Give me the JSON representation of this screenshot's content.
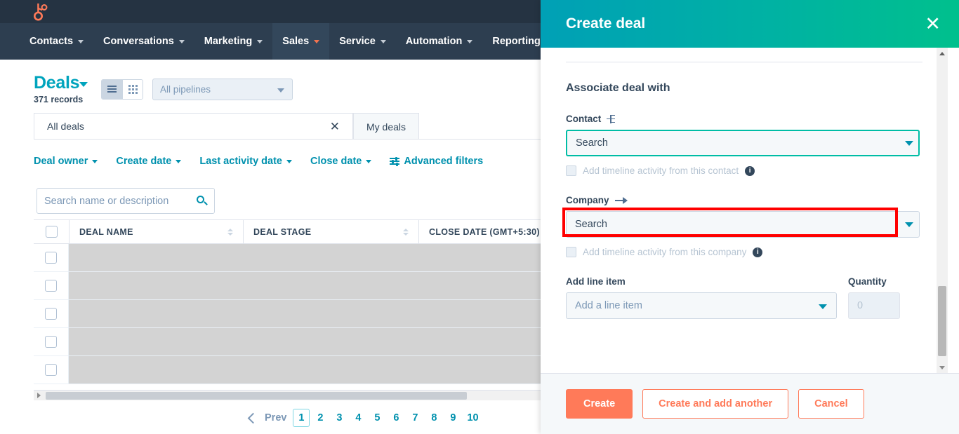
{
  "app": {
    "logo_icon": "hubspot-sprocket-logo",
    "nav_items": [
      {
        "label": "Contacts",
        "active": false
      },
      {
        "label": "Conversations",
        "active": false
      },
      {
        "label": "Marketing",
        "active": false
      },
      {
        "label": "Sales",
        "active": true
      },
      {
        "label": "Service",
        "active": false
      },
      {
        "label": "Automation",
        "active": false
      },
      {
        "label": "Reporting",
        "active": false
      }
    ]
  },
  "deals": {
    "title": "Deals",
    "record_count": "371 records",
    "view_list_icon": "list-view-icon",
    "view_grid_icon": "grid-view-icon",
    "pipeline_filter": "All pipelines",
    "tabs": [
      {
        "label": "All deals",
        "active": true,
        "closable": true
      },
      {
        "label": "My deals",
        "active": false,
        "closable": false
      }
    ],
    "close_tab_icon": "close-icon",
    "filters": [
      {
        "label": "Deal owner",
        "caret": true
      },
      {
        "label": "Create date",
        "caret": true
      },
      {
        "label": "Last activity date",
        "caret": true
      },
      {
        "label": "Close date",
        "caret": true
      },
      {
        "label": "Advanced filters",
        "caret": false,
        "icon": "filter-sliders-icon"
      }
    ],
    "search_placeholder": "Search name or description",
    "search_value": "",
    "search_icon": "search-icon",
    "columns": [
      {
        "label": "DEAL NAME",
        "sortable": true
      },
      {
        "label": "DEAL STAGE",
        "sortable": true
      },
      {
        "label": "CLOSE DATE (GMT+5:30)",
        "sortable": false
      }
    ],
    "row_count": 5,
    "pagination": {
      "prev_label": "Prev",
      "prev_icon": "chevron-left-icon",
      "current": "1",
      "pages": [
        "1",
        "2",
        "3",
        "4",
        "5",
        "6",
        "7",
        "8",
        "9",
        "10"
      ]
    }
  },
  "panel": {
    "title": "Create deal",
    "close_icon": "close-icon",
    "section_title": "Associate deal with",
    "contact": {
      "label": "Contact",
      "icon": "association-icon",
      "placeholder": "Search",
      "value": "",
      "focused": true,
      "checkbox_label": "Add timeline activity from this contact",
      "checkbox_checked": false,
      "info_icon": "info-icon"
    },
    "company": {
      "label": "Company",
      "icon": "arrow-right-icon",
      "placeholder": "Search",
      "value": "",
      "highlighted": true,
      "checkbox_label": "Add timeline activity from this company",
      "checkbox_checked": false,
      "info_icon": "info-icon"
    },
    "line_item": {
      "label": "Add line item",
      "placeholder": "Add a line item",
      "quantity_label": "Quantity",
      "quantity_value": "0"
    },
    "buttons": {
      "create": "Create",
      "create_and_add_another": "Create and add another",
      "cancel": "Cancel"
    }
  },
  "colors": {
    "nav_bg": "#2d3e50",
    "topbar_bg": "#253342",
    "brand_orange": "#ff7a59",
    "teal": "#00a4bd",
    "panel_gradient_start": "#00a0b6",
    "panel_gradient_end": "#00c08d",
    "focus_cyan": "#00bda5",
    "highlight_red": "#ff0000"
  }
}
